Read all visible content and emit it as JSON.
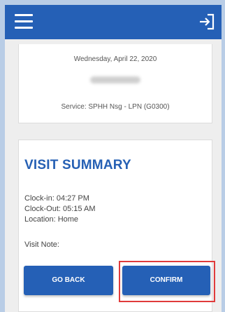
{
  "app": {
    "accent_color": "#2560b6",
    "highlight_color": "#e03b3b"
  },
  "header": {
    "menu_icon": "hamburger-menu-icon",
    "logout_icon": "logout-icon"
  },
  "visit_info": {
    "date": "Wednesday, April 22, 2020",
    "service": "Service: SPHH Nsg - LPN (G0300)"
  },
  "summary": {
    "title": "VISIT SUMMARY",
    "clock_in": "Clock-in: 04:27 PM",
    "clock_out": "Clock-Out: 05:15 AM",
    "location": "Location: Home",
    "visit_note": "Visit Note:"
  },
  "actions": {
    "go_back": "GO BACK",
    "confirm": "CONFIRM"
  }
}
